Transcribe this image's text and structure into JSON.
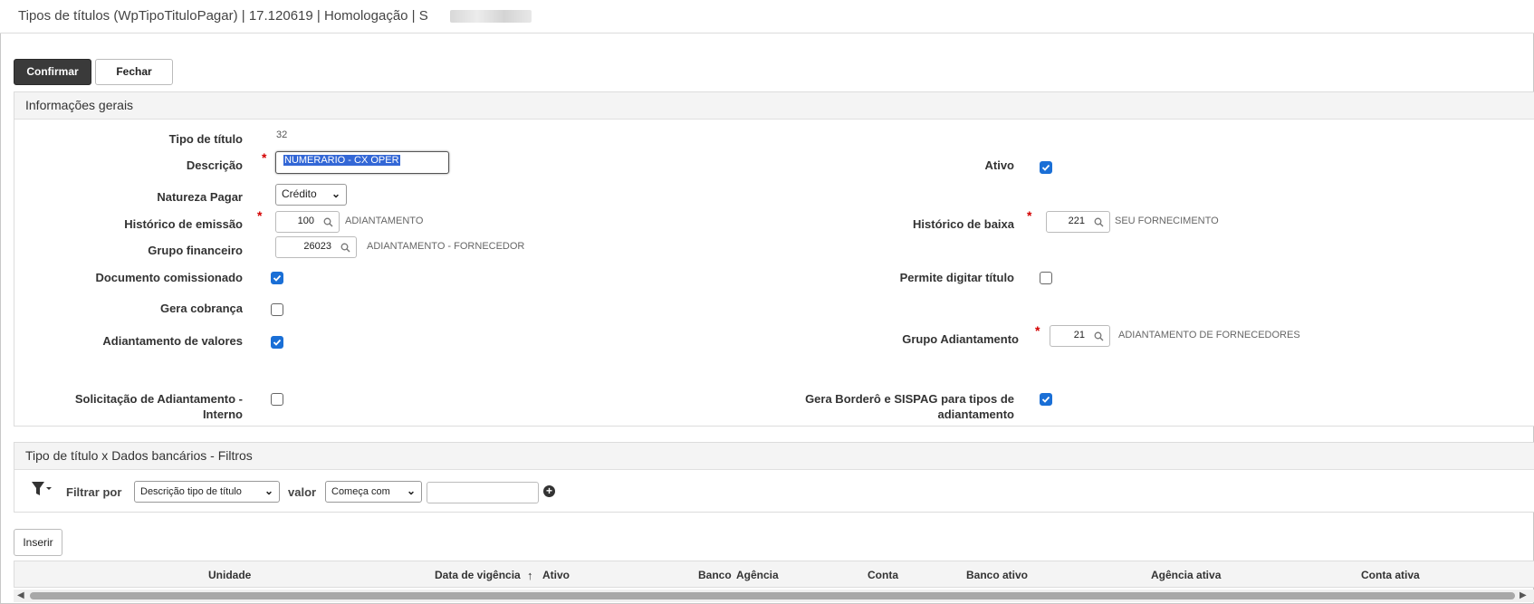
{
  "window": {
    "title": "Tipos de títulos (WpTipoTituloPagar) | 17.120619 | Homologação | S"
  },
  "toolbar": {
    "confirm_label": "Confirmar",
    "close_label": "Fechar"
  },
  "general": {
    "header": "Informações gerais",
    "tipo_titulo_label": "Tipo de título",
    "tipo_titulo_value": "32",
    "descricao_label": "Descrição",
    "descricao_value": "NUMERARIO - CX OPER",
    "ativo_label": "Ativo",
    "ativo_checked": true,
    "natureza_label": "Natureza Pagar",
    "natureza_value": "Crédito",
    "hist_emissao_label": "Histórico de emissão",
    "hist_emissao_value": "100",
    "hist_emissao_desc": "ADIANTAMENTO",
    "hist_baixa_label": "Histórico de baixa",
    "hist_baixa_value": "221",
    "hist_baixa_desc": "SEU FORNECIMENTO",
    "grupo_fin_label": "Grupo financeiro",
    "grupo_fin_value": "26023",
    "grupo_fin_desc": "ADIANTAMENTO - FORNECEDOR",
    "doc_comis_label": "Documento comissionado",
    "doc_comis_checked": true,
    "permite_label": "Permite digitar título",
    "permite_checked": false,
    "gera_cob_label": "Gera cobrança",
    "gera_cob_checked": false,
    "adiant_label": "Adiantamento de valores",
    "adiant_checked": true,
    "grupo_adiant_label": "Grupo Adiantamento",
    "grupo_adiant_value": "21",
    "grupo_adiant_desc": "ADIANTAMENTO DE FORNECEDORES",
    "solic_label_1": "Solicitação de Adiantamento -",
    "solic_label_2": "Interno",
    "solic_checked": false,
    "gera_bordero_label_1": "Gera Borderô e SISPAG para tipos de",
    "gera_bordero_label_2": "adiantamento",
    "gera_bordero_checked": true
  },
  "filters": {
    "header": "Tipo de título x Dados bancários - Filtros",
    "filtrar_label": "Filtrar por",
    "field_value": "Descrição tipo de título",
    "valor_label": "valor",
    "operator_value": "Começa com",
    "input_value": ""
  },
  "grid": {
    "insert_label": "Inserir",
    "columns": [
      "Unidade",
      "Data de vigência",
      "Ativo",
      "Banco",
      "Agência",
      "Conta",
      "Banco ativo",
      "Agência ativa",
      "Conta ativa"
    ],
    "sort_indicator": "↑"
  },
  "colors": {
    "primary_button": "#3a3a3a",
    "checkbox_on": "#1a6fd6",
    "required": "#d40000"
  }
}
